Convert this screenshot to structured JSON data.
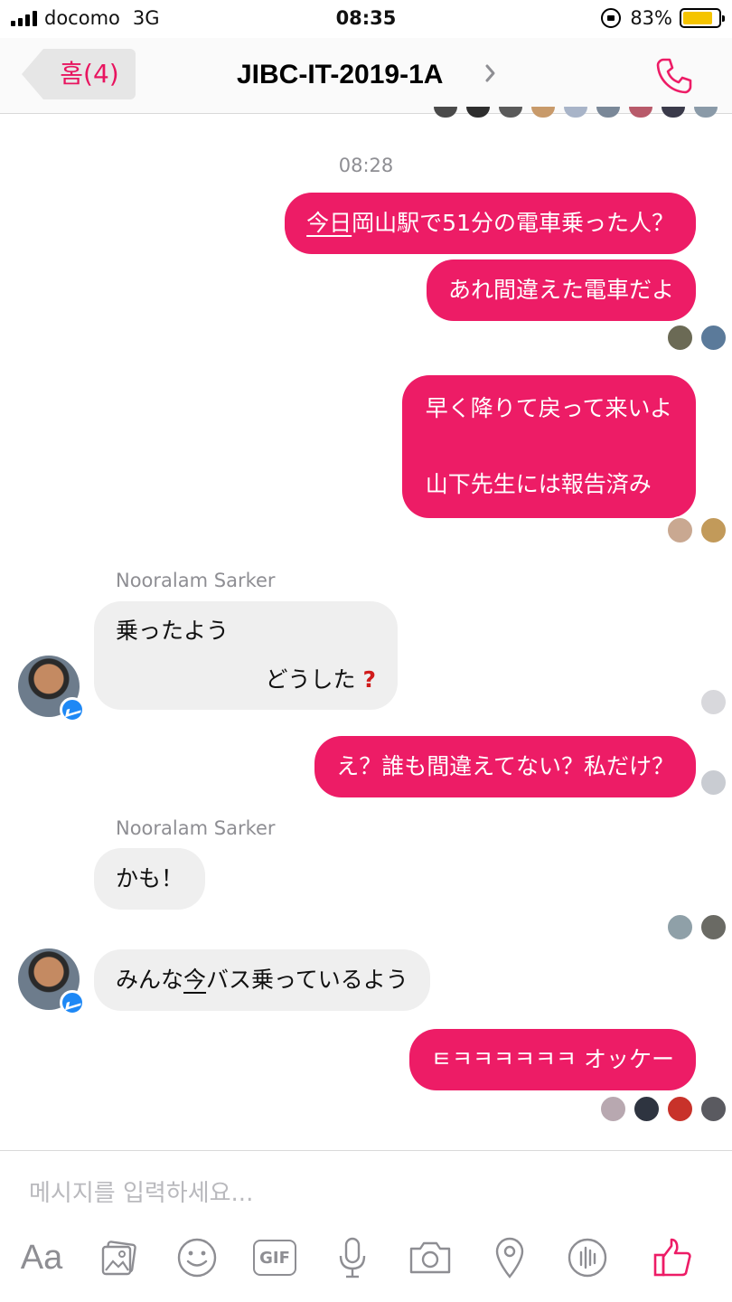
{
  "status": {
    "carrier": "docomo",
    "network": "3G",
    "time": "08:35",
    "battery": "83%",
    "battery_level": 0.83
  },
  "nav": {
    "back_label": "홈(4)",
    "title": "JIBC-IT-2019-1A",
    "chevron_icon": "chevron-right-icon",
    "call_icon": "phone-icon",
    "accent_color": "#ed1c66"
  },
  "chat": {
    "timestamp": "08:28",
    "messages": {
      "m1": {
        "pre": "",
        "u": "今日",
        "post": "岡山駅で51分の電車乗った人？"
      },
      "m2": "あれ間違えた電車だよ",
      "m3": {
        "line1": "早く降りて戻って来いよ",
        "line2": "山下先生には報告済み"
      },
      "m4": {
        "sender": "Nooralam Sarker",
        "line1": "乗ったよう",
        "line2": "どうした"
      },
      "m5": "え？誰も間違えてない？私だけ？",
      "m6": {
        "sender": "Nooralam Sarker",
        "text": "かも！"
      },
      "m7": {
        "pre": "みんな",
        "u": "今",
        "post": "バス乗っているよう"
      },
      "m8": "ㅌㅋㅋㅋㅋㅋㅋ オッケー"
    }
  },
  "composer": {
    "placeholder": "메시지를 입력하세요...",
    "icons": [
      "text-format-icon",
      "gallery-icon",
      "emoji-icon",
      "gif-icon",
      "microphone-icon",
      "camera-icon",
      "location-icon",
      "voice-bars-icon",
      "like-icon"
    ],
    "aa_label": "Aa",
    "gif_label": "GIF"
  }
}
